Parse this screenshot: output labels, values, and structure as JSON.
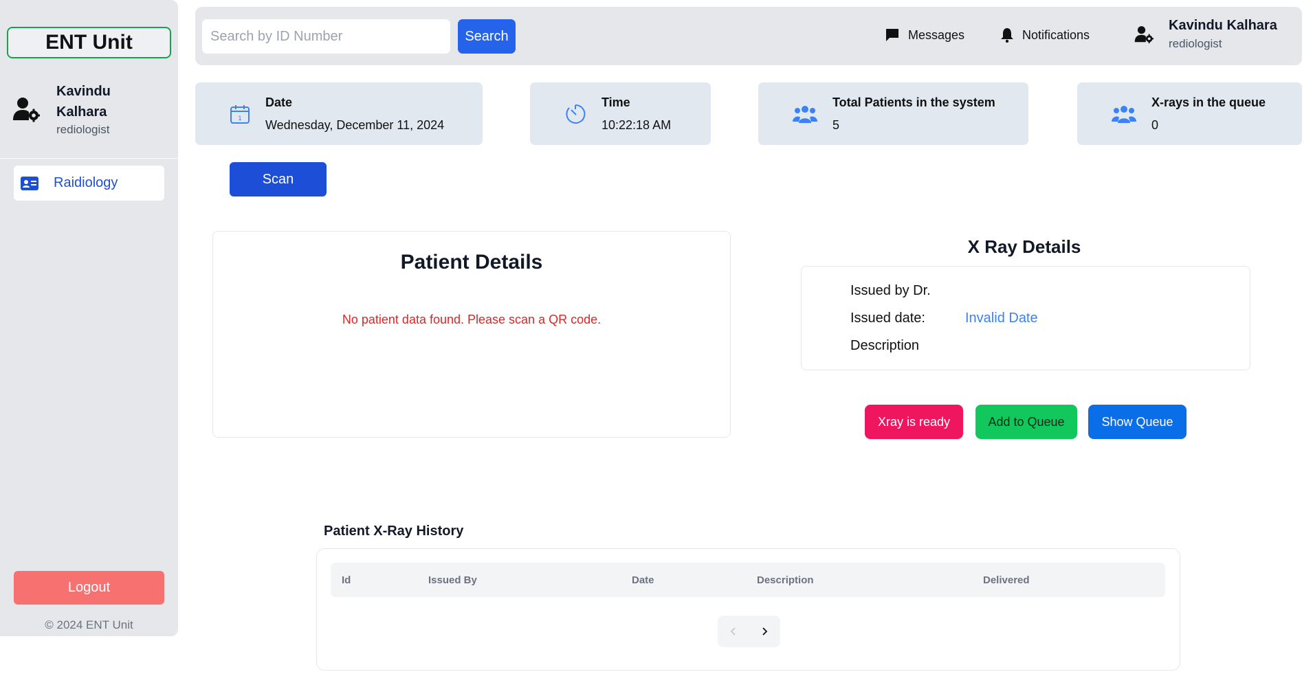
{
  "sidebar": {
    "brand": "ENT Unit",
    "user": {
      "name": "Kavindu Kalhara",
      "role": "rediologist"
    },
    "nav": [
      {
        "label": "Raidiology",
        "icon": "id-card-icon"
      }
    ],
    "logout": "Logout",
    "copyright": "© 2024 ENT Unit"
  },
  "topbar": {
    "search_placeholder": "Search by ID Number",
    "search_value": "",
    "search_button": "Search",
    "messages": "Messages",
    "notifications": "Notifications",
    "user": {
      "name": "Kavindu Kalhara",
      "role": "rediologist"
    }
  },
  "stats": [
    {
      "label": "Date",
      "value": "Wednesday, December 11, 2024",
      "icon": "calendar-icon"
    },
    {
      "label": "Time",
      "value": "10:22:18 AM",
      "icon": "timer-icon"
    },
    {
      "label": "Total Patients in the system",
      "value": "5",
      "icon": "users-icon"
    },
    {
      "label": "X-rays in the queue",
      "value": "0",
      "icon": "users-icon"
    }
  ],
  "scan_button": "Scan",
  "patient": {
    "title": "Patient Details",
    "empty_message": "No patient data found. Please scan a QR code."
  },
  "xray": {
    "title": "X Ray Details",
    "issued_by_label": "Issued by Dr.",
    "issued_by_value": "",
    "issued_date_label": "Issued date:",
    "issued_date_value": "Invalid Date",
    "description_label": "Description",
    "description_value": ""
  },
  "actions": {
    "ready": "Xray is ready",
    "add": "Add to Queue",
    "show": "Show Queue"
  },
  "history": {
    "title": "Patient X-Ray History",
    "columns": [
      "Id",
      "Issued By",
      "Date",
      "Description",
      "Delivered"
    ],
    "rows": []
  },
  "colors": {
    "primary": "#2563eb",
    "scan": "#1d4ed8",
    "ready": "#f0155f",
    "add": "#12c85c",
    "show": "#0a6ee8",
    "logout": "#f87171",
    "error": "#dc2626",
    "brand_border": "#16a34a"
  }
}
